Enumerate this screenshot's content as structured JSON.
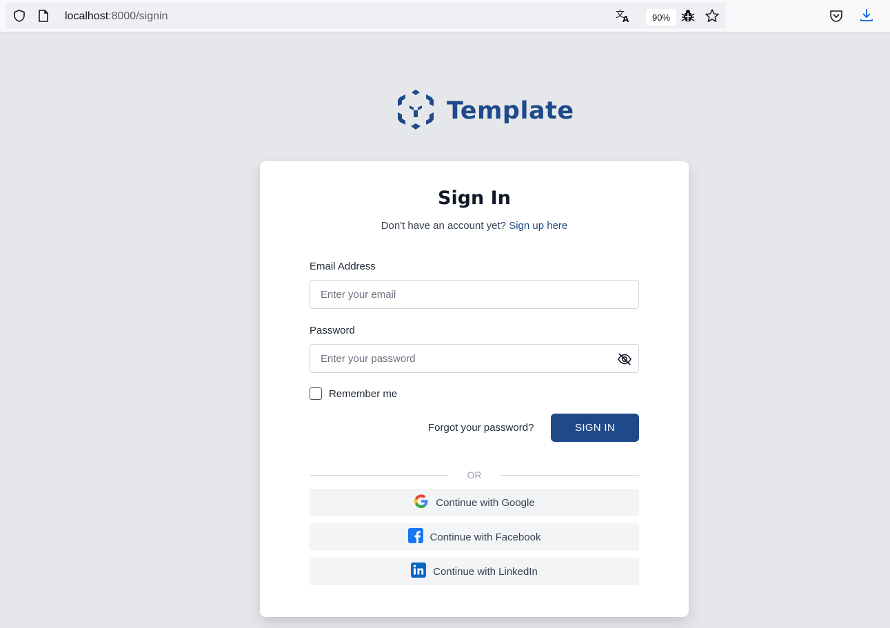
{
  "browser": {
    "url_host": "localhost",
    "url_path": ":8000/signin",
    "zoom": "90%"
  },
  "brand": {
    "name": "Template",
    "color": "#1e4a8a"
  },
  "signin": {
    "title": "Sign In",
    "subtitle_text": "Don't have an account yet?",
    "signup_link": "Sign up here",
    "email_label": "Email Address",
    "email_placeholder": "Enter your email",
    "password_label": "Password",
    "password_placeholder": "Enter your password",
    "remember_label": "Remember me",
    "remember_checked": false,
    "forgot_link": "Forgot your password?",
    "submit_label": "SIGN IN",
    "divider_text": "OR"
  },
  "social": [
    {
      "label": "Continue with Google",
      "icon": "google-icon"
    },
    {
      "label": "Continue with Facebook",
      "icon": "facebook-icon"
    },
    {
      "label": "Continue with LinkedIn",
      "icon": "linkedin-icon"
    }
  ]
}
